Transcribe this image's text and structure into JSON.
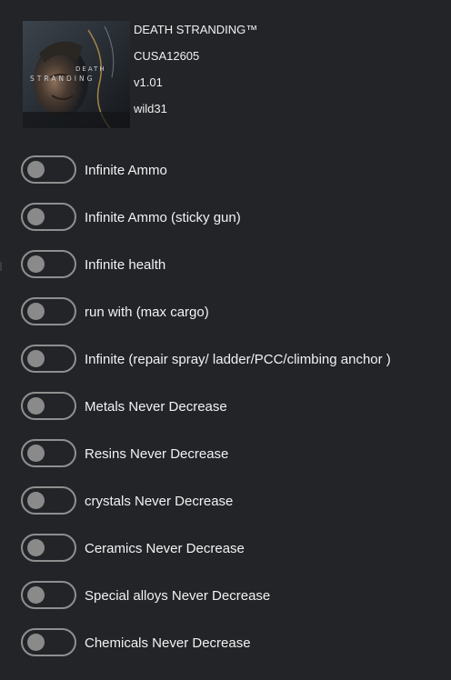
{
  "game": {
    "title": "DEATH STRANDING™",
    "id": "CUSA12605",
    "version": "v1.01",
    "author": "wild31",
    "cover_art_text": "DEATH STRANDING"
  },
  "colors": {
    "background": "#222428",
    "switch_border": "#8f8f8f",
    "knob": "#8a8a8a",
    "text": "#f2f2f2"
  },
  "toggles": [
    {
      "label": "Infinite Ammo",
      "enabled": false
    },
    {
      "label": "Infinite Ammo (sticky gun)",
      "enabled": false
    },
    {
      "label": "Infinite health",
      "enabled": false
    },
    {
      "label": "run with (max cargo)",
      "enabled": false
    },
    {
      "label": "Infinite (repair spray/ ladder/PCC/climbing anchor )",
      "enabled": false
    },
    {
      "label": "Metals Never Decrease",
      "enabled": false
    },
    {
      "label": "Resins Never Decrease",
      "enabled": false
    },
    {
      "label": "crystals Never Decrease",
      "enabled": false
    },
    {
      "label": "Ceramics Never Decrease",
      "enabled": false
    },
    {
      "label": "Special alloys Never Decrease",
      "enabled": false
    },
    {
      "label": "Chemicals Never Decrease",
      "enabled": false
    }
  ]
}
